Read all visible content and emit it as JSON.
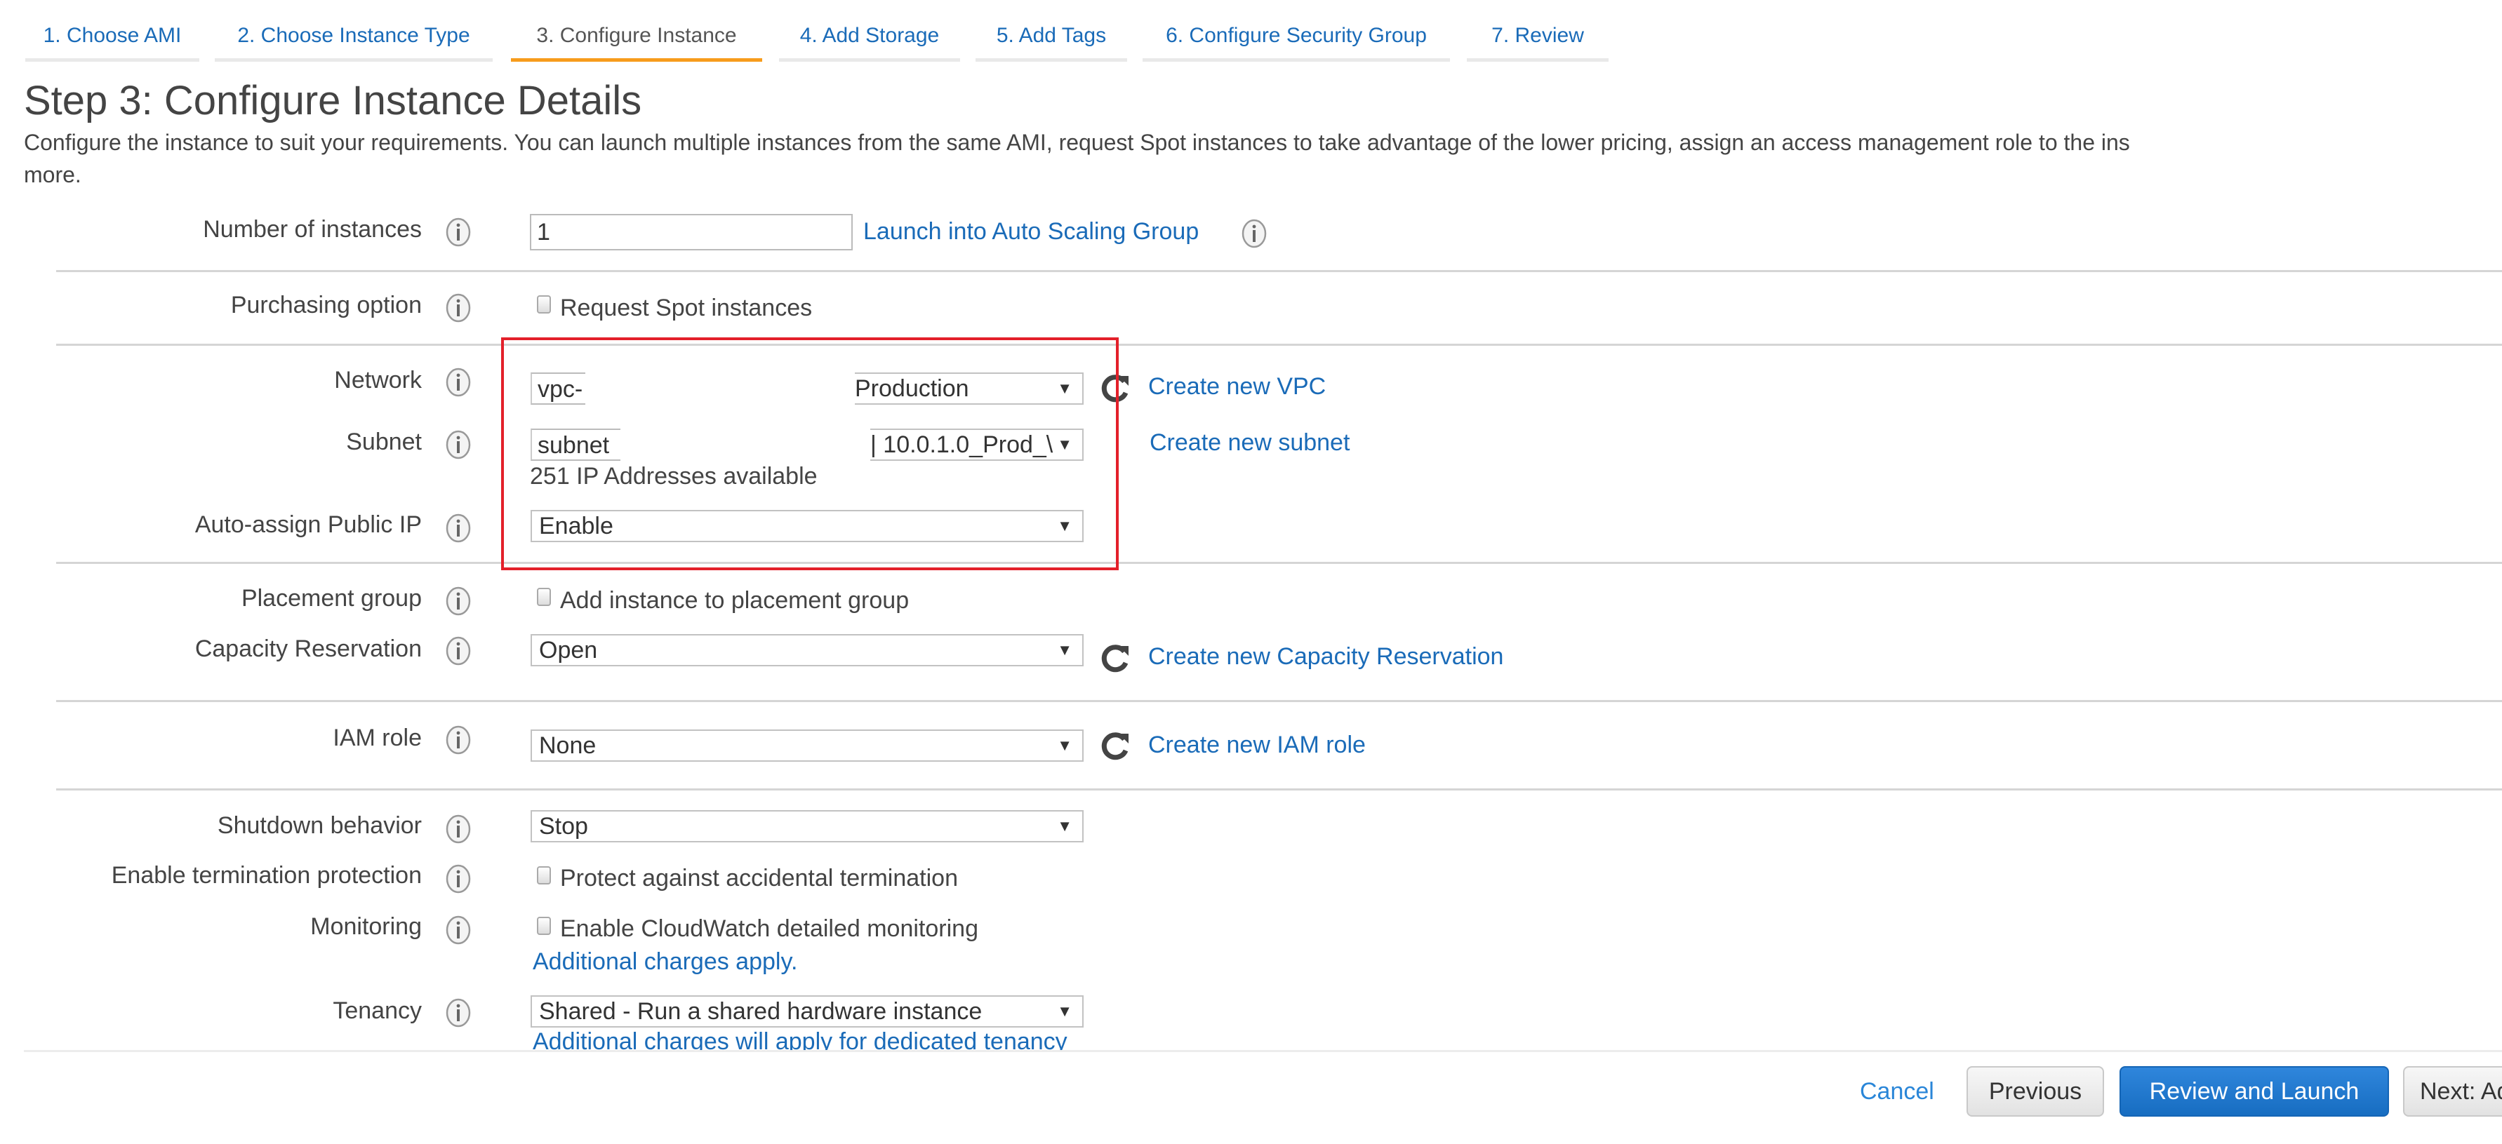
{
  "wizard_tabs": [
    {
      "label": "1. Choose AMI",
      "active": false
    },
    {
      "label": "2. Choose Instance Type",
      "active": false
    },
    {
      "label": "3. Configure Instance",
      "active": true
    },
    {
      "label": "4. Add Storage",
      "active": false
    },
    {
      "label": "5. Add Tags",
      "active": false
    },
    {
      "label": "6. Configure Security Group",
      "active": false
    },
    {
      "label": "7. Review",
      "active": false
    }
  ],
  "page": {
    "title": "Step 3: Configure Instance Details",
    "description_line1": "Configure the instance to suit your requirements. You can launch multiple instances from the same AMI, request Spot instances to take advantage of the lower pricing, assign an access management role to the ins",
    "description_line2": "more."
  },
  "form": {
    "number_of_instances": {
      "label": "Number of instances",
      "value": "1",
      "link": "Launch into Auto Scaling Group"
    },
    "purchasing_option": {
      "label": "Purchasing option",
      "checkbox_label": "Request Spot instances",
      "checked": false
    },
    "network": {
      "label": "Network",
      "id_value": "vpc-",
      "selected": "Production",
      "link": "Create new VPC"
    },
    "subnet": {
      "label": "Subnet",
      "id_value": "subnet",
      "selected": "| 10.0.1.0_Prod_\\",
      "ip_available": "251 IP Addresses available",
      "link": "Create new subnet"
    },
    "auto_assign_public_ip": {
      "label": "Auto-assign Public IP",
      "selected": "Enable"
    },
    "placement_group": {
      "label": "Placement group",
      "checkbox_label": "Add instance to placement group",
      "checked": false
    },
    "capacity_reservation": {
      "label": "Capacity Reservation",
      "selected": "Open",
      "link": "Create new Capacity Reservation"
    },
    "iam_role": {
      "label": "IAM role",
      "selected": "None",
      "link": "Create new IAM role"
    },
    "shutdown_behavior": {
      "label": "Shutdown behavior",
      "selected": "Stop"
    },
    "termination_protection": {
      "label": "Enable termination protection",
      "checkbox_label": "Protect against accidental termination",
      "checked": false
    },
    "monitoring": {
      "label": "Monitoring",
      "checkbox_label": "Enable CloudWatch detailed monitoring",
      "checked": false,
      "link": "Additional charges apply."
    },
    "tenancy": {
      "label": "Tenancy",
      "selected": "Shared - Run a shared hardware instance",
      "link": "Additional charges will apply for dedicated tenancy"
    }
  },
  "icons": {
    "caret": "▼",
    "info": "info-icon",
    "refresh": "refresh-icon"
  },
  "footer": {
    "cancel": "Cancel",
    "previous": "Previous",
    "review_and_launch": "Review and Launch",
    "next": "Next: Add Storage"
  },
  "colors": {
    "accent_tab": "#f79c1c",
    "link": "#1a6bb8",
    "primary_button": "#1f75cc",
    "highlight_box": "#e3202a"
  }
}
